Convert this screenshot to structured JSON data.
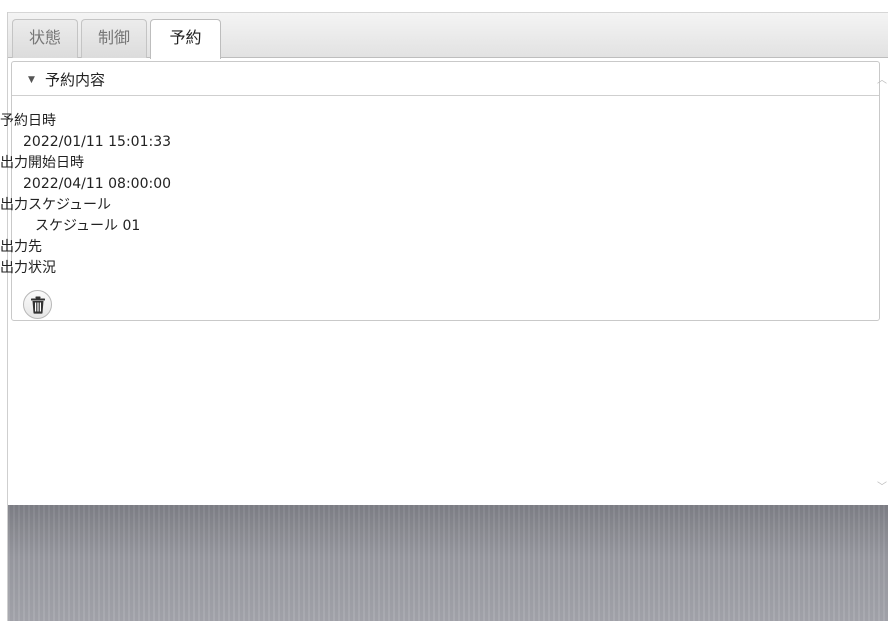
{
  "tabs": [
    {
      "label": "状態"
    },
    {
      "label": "制御"
    },
    {
      "label": "予約"
    }
  ],
  "active_tab": "予約",
  "panel": {
    "title": "予約内容"
  },
  "details": {
    "reserve_datetime_label": "予約日時",
    "reserve_datetime_value": "2022/01/11 15:01:33",
    "output_start_label": "出力開始日時",
    "output_start_value": "2022/04/11 08:00:00",
    "output_schedule_label": "出力スケジュール",
    "output_schedule_value": "スケジュール 01",
    "output_destination_label": "出力先",
    "output_status_label": "出力状況"
  },
  "icons": {
    "collapse": "caret-down-icon",
    "delete": "trash-icon",
    "scroll_up": "chevron-up-icon",
    "scroll_down": "chevron-down-icon"
  },
  "colors": {
    "tab_inactive_text": "#777777",
    "border": "#c9c9c9",
    "footer": "#9a9ba2"
  }
}
